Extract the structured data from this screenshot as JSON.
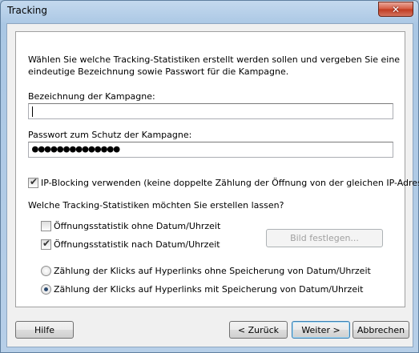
{
  "window": {
    "title": "Tracking",
    "close_glyph": "✕"
  },
  "intro": "Wählen Sie welche Tracking-Statistiken erstellt werden sollen und vergeben Sie eine eindeutige Bezeichnung sowie Passwort für die Kampagne.",
  "campaign": {
    "label": "Bezeichnung der Kampagne:",
    "value": ""
  },
  "password": {
    "label": "Passwort zum Schutz der Kampagne:",
    "value": "●●●●●●●●●●●●●●"
  },
  "ip_blocking": {
    "label": "IP-Blocking verwenden (keine doppelte Zählung der Öffnung von der gleichen IP-Adresse)",
    "checked": true
  },
  "stats_question": "Welche Tracking-Statistiken möchten Sie erstellen lassen?",
  "options": {
    "open_no_date": {
      "label": "Öffnungsstatistik ohne Datum/Uhrzeit",
      "checked": false
    },
    "open_with_date": {
      "label": "Öffnungsstatistik nach Datum/Uhrzeit",
      "checked": true
    },
    "set_image_button": "Bild festlegen...",
    "clicks_no_date": {
      "label": "Zählung der Klicks auf Hyperlinks ohne Speicherung von Datum/Uhrzeit",
      "selected": false
    },
    "clicks_with_date": {
      "label": "Zählung der Klicks auf Hyperlinks mit Speicherung von Datum/Uhrzeit",
      "selected": true
    }
  },
  "buttons": {
    "help": "Hilfe",
    "back": "< Zurück",
    "next": "Weiter >",
    "cancel": "Abbrechen"
  }
}
